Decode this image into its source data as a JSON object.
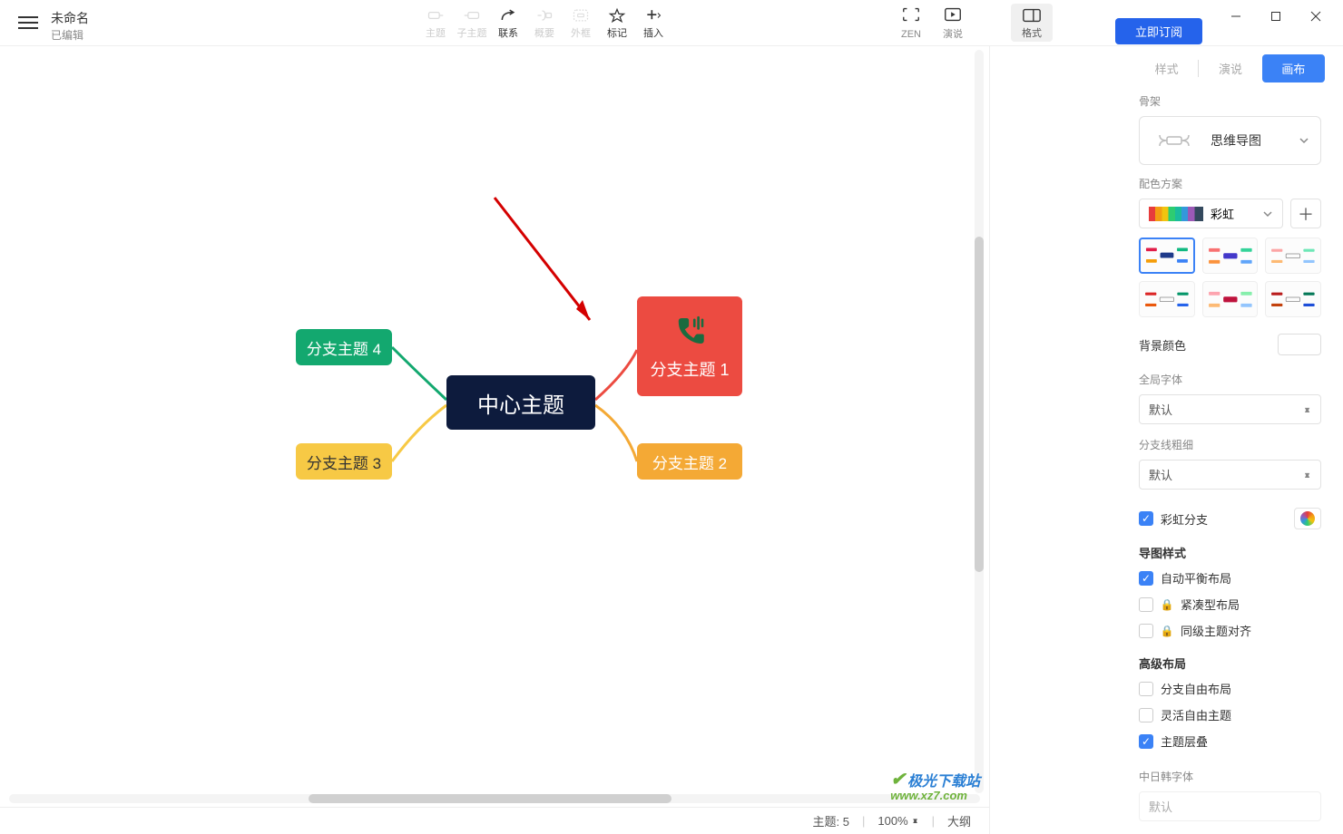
{
  "doc": {
    "title": "未命名",
    "subtitle": "已编辑"
  },
  "toolbar": {
    "topic": "主题",
    "subtopic": "子主题",
    "relation": "联系",
    "summary": "概要",
    "boundary": "外框",
    "marker": "标记",
    "insert": "插入",
    "zen": "ZEN",
    "present": "演说",
    "format": "格式"
  },
  "subscribe": "立即订阅",
  "mindmap": {
    "center": "中心主题",
    "b1": "分支主题 1",
    "b2": "分支主题 2",
    "b3": "分支主题 3",
    "b4": "分支主题 4"
  },
  "panel": {
    "tab_style": "样式",
    "tab_present": "演说",
    "tab_canvas": "画布",
    "skeleton_label": "骨架",
    "skeleton_value": "思维导图",
    "color_scheme_label": "配色方案",
    "color_scheme_value": "彩虹",
    "bg_label": "背景颜色",
    "font_label": "全局字体",
    "font_value": "默认",
    "line_label": "分支线粗细",
    "line_value": "默认",
    "rainbow_branch": "彩虹分支",
    "style_title": "导图样式",
    "auto_balance": "自动平衡布局",
    "compact": "紧凑型布局",
    "same_level": "同级主题对齐",
    "adv_title": "高级布局",
    "free_branch": "分支自由布局",
    "free_topic": "灵活自由主题",
    "topic_overlap": "主题层叠",
    "cjk_label": "中日韩字体",
    "cjk_value": "默认"
  },
  "status": {
    "topics_label": "主题:",
    "topics_count": "5",
    "zoom": "100%",
    "outline": "大纲"
  },
  "watermark": {
    "top": "极光下载站",
    "bot": "www.xz7.com"
  }
}
